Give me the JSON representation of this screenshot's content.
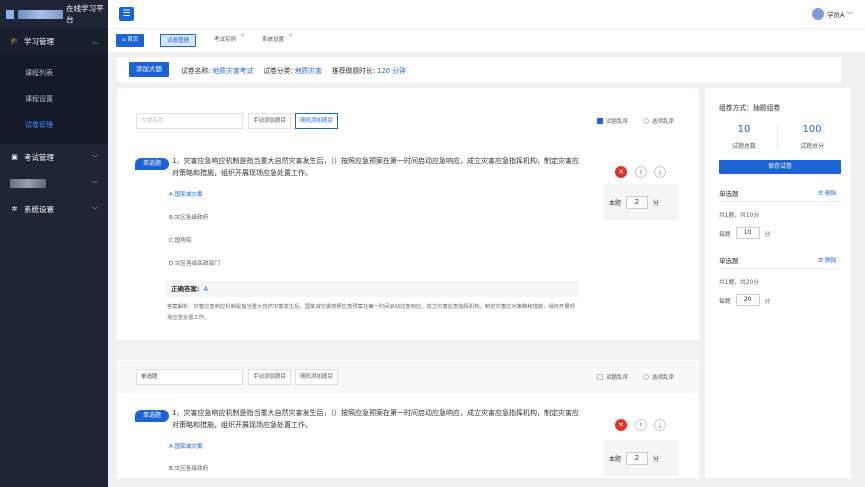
{
  "app": {
    "title": "在线学习平台"
  },
  "sidebar": {
    "groups": [
      {
        "label": "学习管理",
        "icon": "graduation-cap-icon"
      },
      {
        "label": "考试管理",
        "icon": "exam-icon"
      },
      {
        "label": "系统设置",
        "icon": "gear-icon"
      }
    ],
    "items": [
      "课程列表",
      "课程设置",
      "试卷管理"
    ]
  },
  "topbar": {
    "user": "学员A"
  },
  "tabs": [
    {
      "label": "首页"
    },
    {
      "label": "试卷管理"
    },
    {
      "label": "考试实例"
    },
    {
      "label": "系统设置"
    }
  ],
  "info": {
    "add_button": "添加大题",
    "name_label": "试卷名称:",
    "name_value": "地质灾害考试",
    "category_label": "试卷分类:",
    "category_value": "地质灾害",
    "duration_label": "推荐做题时长:",
    "duration_value": "120 分钟"
  },
  "filter1": {
    "placeholder": "大题名称",
    "manual_btn": "手动添加题目",
    "random_btn": "随机添加题目",
    "shuffle_q": "试题乱序",
    "shuffle_opt": "选项乱序"
  },
  "filter2": {
    "value": "单选题",
    "manual_btn": "手动添加题目",
    "random_btn": "随机添加题目",
    "shuffle_q": "试题乱序",
    "shuffle_opt": "选项乱序"
  },
  "question1": {
    "badge": "单选题",
    "text": "1、灾害应急响应机制是指当重大自然灾害发生后，（）按照应急预案在第一时间启动应急响应，成立灾害应急指挥机构，制定灾害应对策略和措施，组织开展现场应急处置工作。",
    "options": [
      "A.国家减灾委",
      "B.灾区各级政府",
      "C.国务院",
      "D.灾区各级民政部门"
    ],
    "answer_label": "正确答案:",
    "answer_value": "A",
    "analysis": "答案解析：灾害应急响应机制是指当重大自然灾害发生后，国家减灾委按照应急预案在第一时间启动应急响应，成立灾害应急指挥机构，制定灾害应对策略和措施，组织开展现场应急处置工作。",
    "score_label": "本题",
    "score_value": "2",
    "score_unit": "分"
  },
  "question2": {
    "badge": "单选题",
    "text": "1、灾害应急响应机制是指当重大自然灾害发生后，（）按照应急预案在第一时间启动应急响应，成立灾害应急指挥机构，制定灾害应对策略和措施，组织开展现场应急处置工作。",
    "options": [
      "A.国家减灾委",
      "B.灾区各级政府"
    ],
    "score_label": "本题",
    "score_value": "2",
    "score_unit": "分"
  },
  "right": {
    "mode": "组卷方式：抽题组卷",
    "total_count": "10",
    "total_count_label": "试题总数",
    "total_score": "100",
    "total_score_label": "试题总分",
    "save_btn": "保存试卷",
    "sections": [
      {
        "title": "单选题",
        "del": "删除",
        "info": "共1题，共10分",
        "each_label": "每题",
        "each_value": "10",
        "unit": "分"
      },
      {
        "title": "单选题",
        "del": "删除",
        "info": "共1题，共20分",
        "each_label": "每题",
        "each_value": "20",
        "unit": "分"
      }
    ]
  },
  "icons": {
    "home": "home-icon",
    "delete": "delete-icon",
    "up": "arrow-up-icon",
    "down": "arrow-down-icon",
    "menu": "menu-icon"
  },
  "colors": {
    "primary": "#1e63d6",
    "sidebar": "#1f2436",
    "danger": "#e0342b"
  }
}
